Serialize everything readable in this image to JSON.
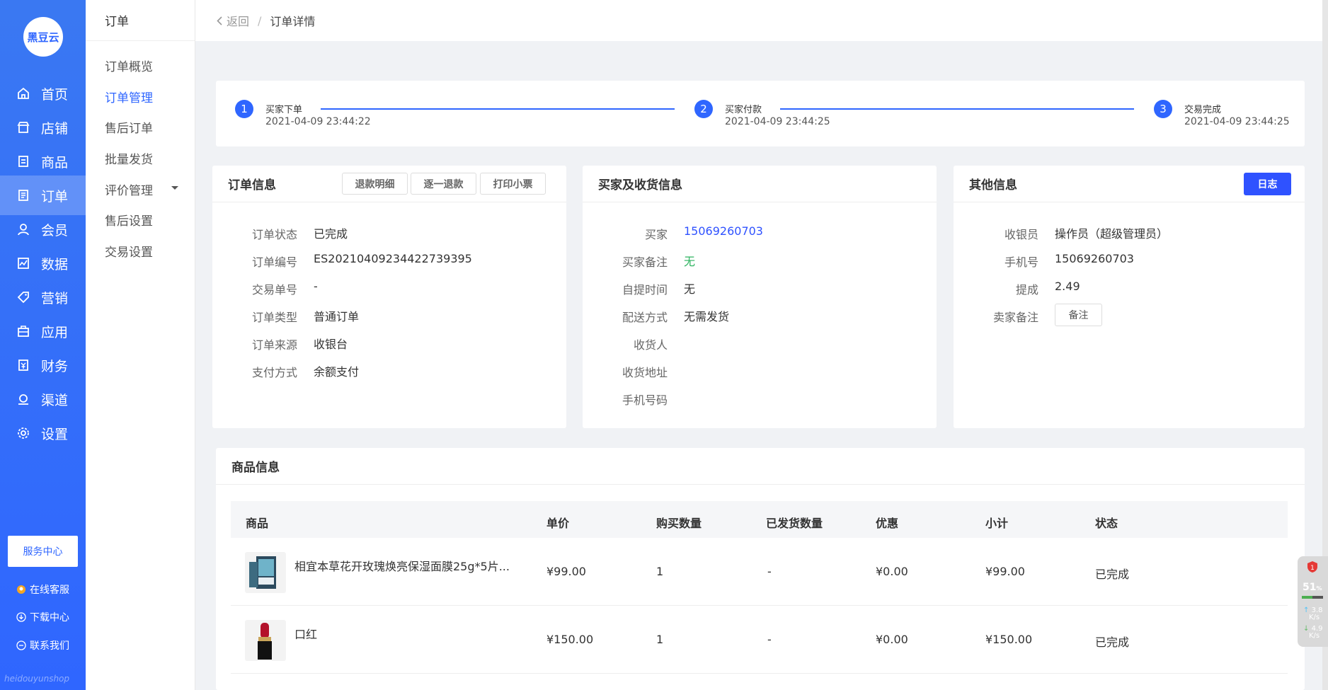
{
  "brand": {
    "logo_text": "黑豆云",
    "footer_text": "heidouyunshop"
  },
  "sidebar": {
    "items": [
      {
        "label": "首页",
        "icon": "home-icon"
      },
      {
        "label": "店铺",
        "icon": "store-icon"
      },
      {
        "label": "商品",
        "icon": "goods-icon"
      },
      {
        "label": "订单",
        "icon": "order-icon",
        "active": true
      },
      {
        "label": "会员",
        "icon": "member-icon"
      },
      {
        "label": "数据",
        "icon": "chart-icon"
      },
      {
        "label": "营销",
        "icon": "tag-icon"
      },
      {
        "label": "应用",
        "icon": "app-icon"
      },
      {
        "label": "财务",
        "icon": "finance-icon"
      },
      {
        "label": "渠道",
        "icon": "channel-icon"
      },
      {
        "label": "设置",
        "icon": "gear-icon"
      }
    ],
    "service_center": "服务中心",
    "links": [
      {
        "label": "在线客服",
        "icon": "customer-service-icon"
      },
      {
        "label": "下载中心",
        "icon": "download-icon"
      },
      {
        "label": "联系我们",
        "icon": "contact-icon"
      }
    ]
  },
  "subnav": {
    "title": "订单",
    "items": [
      {
        "label": "订单概览"
      },
      {
        "label": "订单管理",
        "active": true
      },
      {
        "label": "售后订单"
      },
      {
        "label": "批量发货"
      },
      {
        "label": "评价管理"
      },
      {
        "label": "售后设置"
      },
      {
        "label": "交易设置"
      }
    ]
  },
  "breadcrumb": {
    "back": "返回",
    "separator": "/",
    "current": "订单详情"
  },
  "steps": [
    {
      "num": "1",
      "title": "买家下单",
      "time": "2021-04-09 23:44:22"
    },
    {
      "num": "2",
      "title": "买家付款",
      "time": "2021-04-09 23:44:25"
    },
    {
      "num": "3",
      "title": "交易完成",
      "time": "2021-04-09 23:44:25"
    }
  ],
  "order_info": {
    "title": "订单信息",
    "buttons": [
      "退款明细",
      "逐一退款",
      "打印小票"
    ],
    "rows": [
      {
        "label": "订单状态",
        "value": "已完成"
      },
      {
        "label": "订单编号",
        "value": "ES20210409234422739395"
      },
      {
        "label": "交易单号",
        "value": "-"
      },
      {
        "label": "订单类型",
        "value": "普通订单"
      },
      {
        "label": "订单来源",
        "value": "收银台"
      },
      {
        "label": "支付方式",
        "value": "余额支付"
      }
    ]
  },
  "buyer_info": {
    "title": "买家及收货信息",
    "rows": [
      {
        "label": "买家",
        "value": "15069260703"
      },
      {
        "label": "买家备注",
        "value": "无"
      },
      {
        "label": "自提时间",
        "value": "无"
      },
      {
        "label": "配送方式",
        "value": "无需发货"
      },
      {
        "label": "收货人",
        "value": ""
      },
      {
        "label": "收货地址",
        "value": ""
      },
      {
        "label": "手机号码",
        "value": ""
      }
    ]
  },
  "other_info": {
    "title": "其他信息",
    "log_button": "日志",
    "rows": [
      {
        "label": "收银员",
        "value": "操作员（超级管理员）"
      },
      {
        "label": "手机号",
        "value": "15069260703"
      },
      {
        "label": "提成",
        "value": "2.49"
      },
      {
        "label": "卖家备注",
        "value": ""
      }
    ],
    "remark_button": "备注"
  },
  "goods": {
    "title": "商品信息",
    "columns": [
      "商品",
      "单价",
      "购买数量",
      "已发货数量",
      "优惠",
      "小计",
      "状态"
    ],
    "rows": [
      {
        "name": "相宜本草花开玫瑰焕亮保湿面膜25g*5片...",
        "price": "¥99.00",
        "qty": "1",
        "shipped": "-",
        "discount": "¥0.00",
        "subtotal": "¥99.00",
        "status": "已完成"
      },
      {
        "name": "口红",
        "price": "¥150.00",
        "qty": "1",
        "shipped": "-",
        "discount": "¥0.00",
        "subtotal": "¥150.00",
        "status": "已完成"
      }
    ]
  },
  "widget": {
    "percent": "51",
    "percent_unit": "%",
    "up_speed": "3.8",
    "down_speed": "4.9",
    "unit": "K/s",
    "load_fraction": 0.51
  },
  "colors": {
    "primary": "#2f66ff",
    "button_primary": "#2f52ff",
    "green": "#2db35f"
  }
}
